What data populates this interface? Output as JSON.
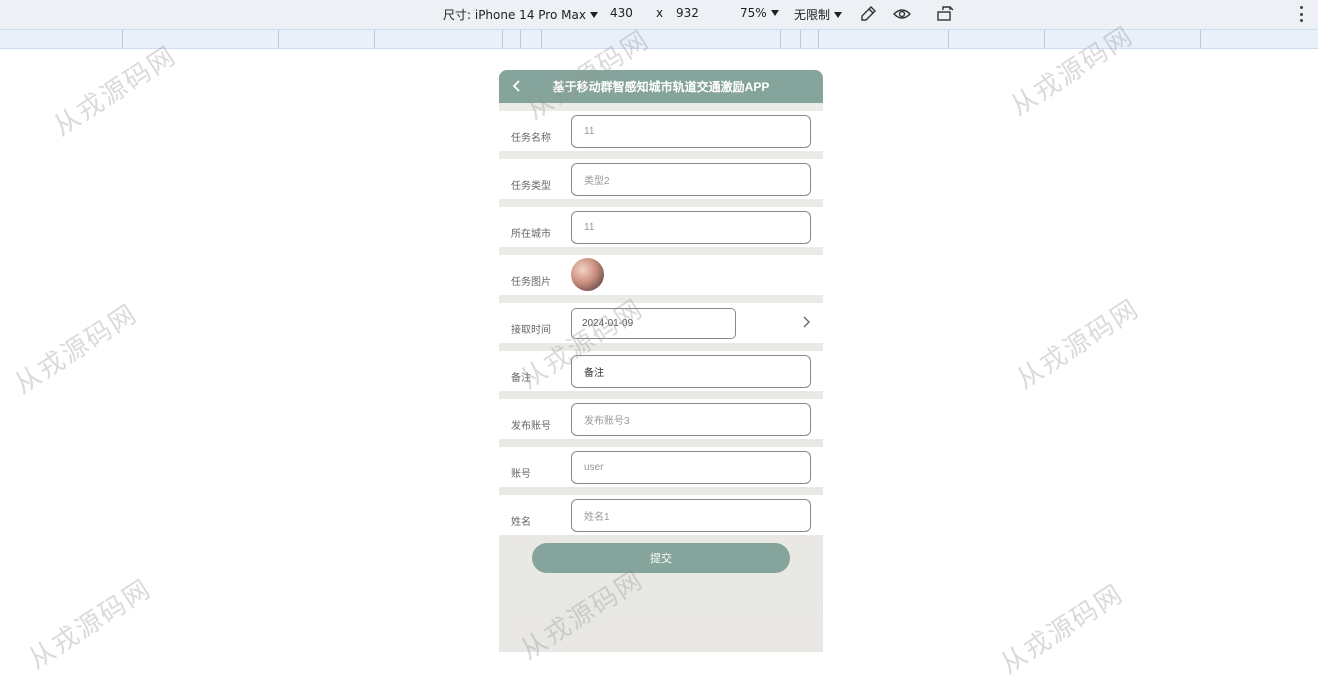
{
  "devtools": {
    "size_label": "尺寸: iPhone 14 Pro Max",
    "width": "430",
    "times": "x",
    "height": "932",
    "zoom": "75%",
    "throttle": "无限制"
  },
  "app": {
    "title": "基于移动群智感知城市轨道交通激励APP",
    "fields": [
      {
        "label": "任务名称",
        "value": "11"
      },
      {
        "label": "任务类型",
        "value": "类型2"
      },
      {
        "label": "所在城市",
        "value": "11"
      },
      {
        "label": "任务图片",
        "value": ""
      },
      {
        "label": "接取时间",
        "value": "2024-01-09"
      },
      {
        "label": "备注",
        "value": "备注"
      },
      {
        "label": "发布账号",
        "value": "发布账号3"
      },
      {
        "label": "账号",
        "value": "user"
      },
      {
        "label": "姓名",
        "value": "姓名1"
      }
    ],
    "submit_label": "提交"
  },
  "watermark": "从戎源码网"
}
